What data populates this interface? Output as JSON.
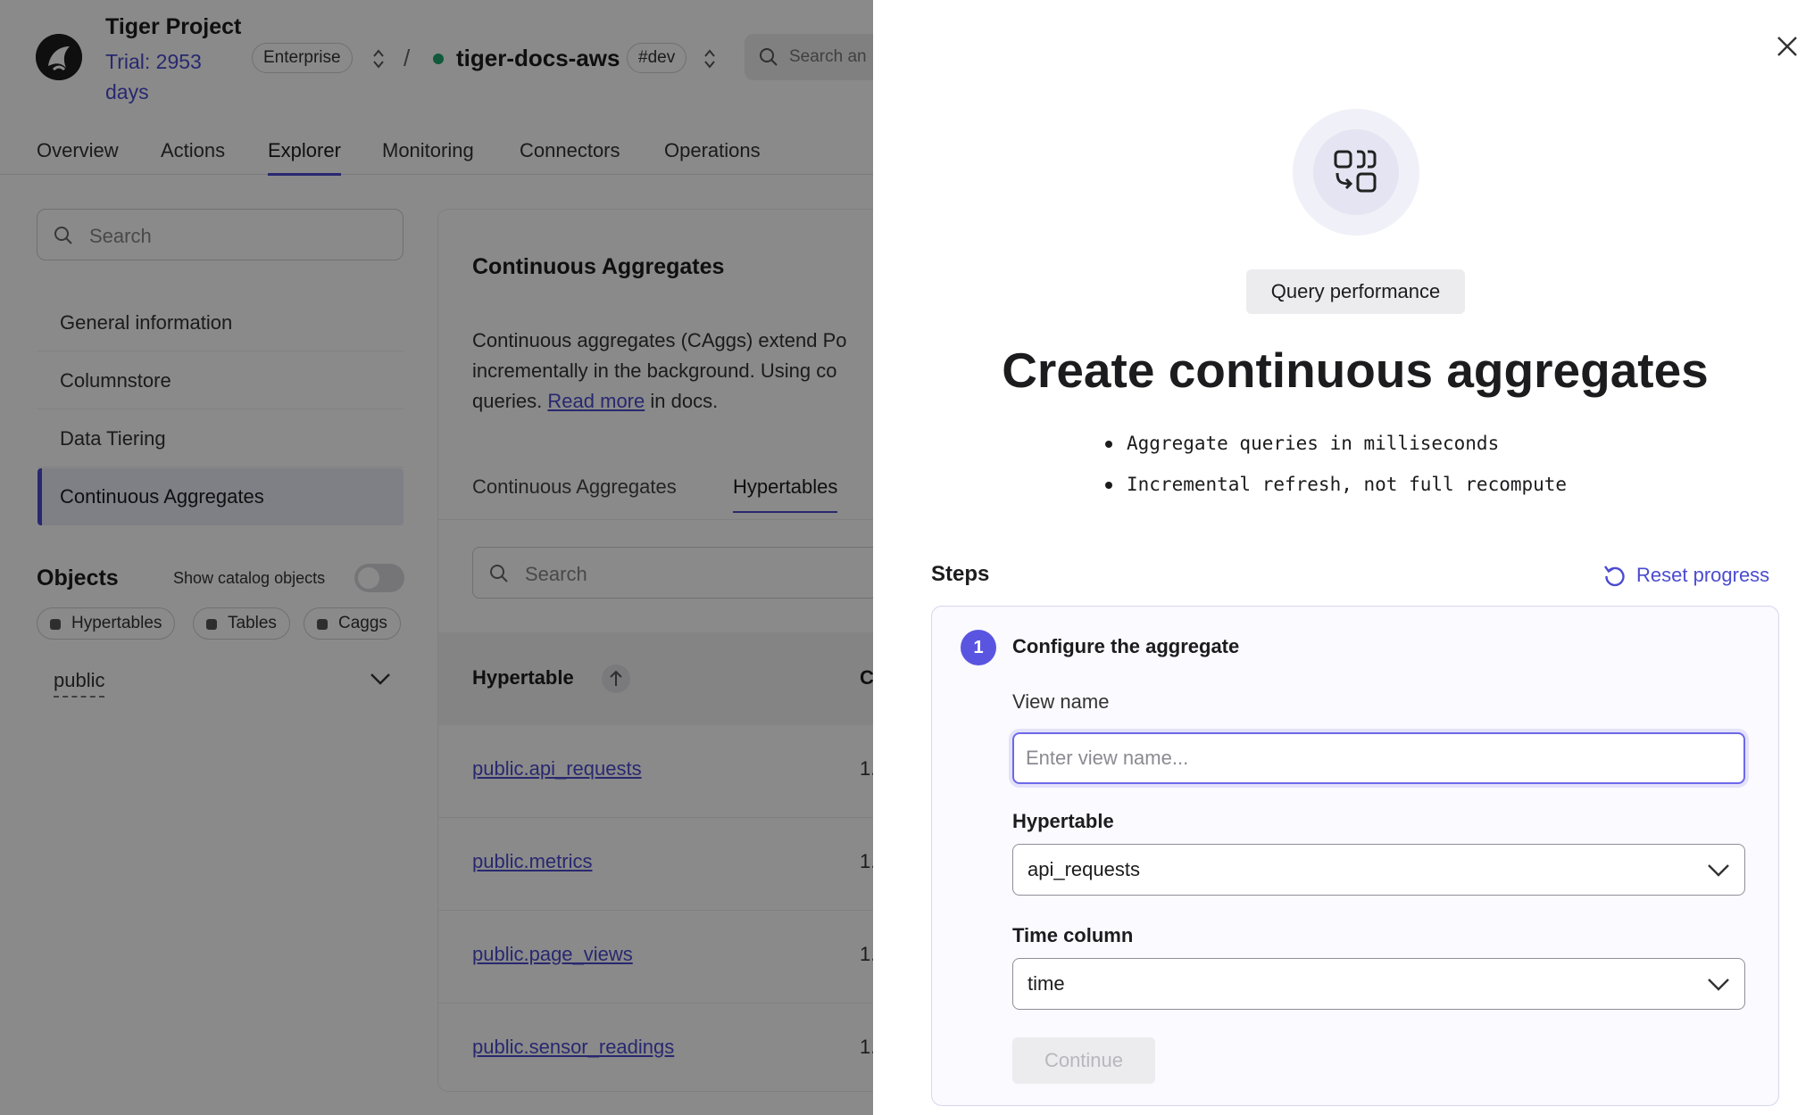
{
  "header": {
    "project_name": "Tiger Project",
    "trial": "Trial: 2953 days",
    "plan": "Enterprise",
    "separator": "/",
    "service_name": "tiger-docs-aws",
    "env_tag": "#dev",
    "search_placeholder": "Search an"
  },
  "nav": {
    "tabs": [
      "Overview",
      "Actions",
      "Explorer",
      "Monitoring",
      "Connectors",
      "Operations"
    ],
    "active": "Explorer"
  },
  "sidebar": {
    "search_placeholder": "Search",
    "items": [
      "General information",
      "Columnstore",
      "Data Tiering",
      "Continuous Aggregates"
    ],
    "active_item": "Continuous Aggregates",
    "objects_title": "Objects",
    "show_catalog_label": "Show catalog objects",
    "chips": [
      "Hypertables",
      "Tables",
      "Caggs"
    ],
    "schema": "public"
  },
  "main": {
    "title": "Continuous Aggregates",
    "desc_line1": "Continuous aggregates (CAggs) extend Po",
    "desc_line2": "incrementally in the background. Using co",
    "desc_line3_pre": "queries.",
    "desc_link": "Read more",
    "desc_line3_post": "in docs.",
    "tabs": [
      "Continuous Aggregates",
      "Hypertables"
    ],
    "active_tab": "Hypertables",
    "table_search_placeholder": "Search",
    "column_header": "Hypertable",
    "column_header_2": "C",
    "rows": [
      {
        "name": "public.api_requests",
        "value": "1."
      },
      {
        "name": "public.metrics",
        "value": "1."
      },
      {
        "name": "public.page_views",
        "value": "1."
      },
      {
        "name": "public.sensor_readings",
        "value": "1."
      }
    ]
  },
  "drawer": {
    "badge": "Query performance",
    "title": "Create continuous aggregates",
    "bullets": [
      "Aggregate queries in milliseconds",
      "Incremental refresh, not full recompute"
    ],
    "steps_label": "Steps",
    "reset_label": "Reset progress",
    "step": {
      "number": "1",
      "title": "Configure the aggregate",
      "view_name_label": "View name",
      "view_name_placeholder": "Enter view name...",
      "view_name_value": "",
      "hypertable_label": "Hypertable",
      "hypertable_value": "api_requests",
      "time_column_label": "Time column",
      "time_column_value": "time",
      "continue_label": "Continue"
    }
  },
  "colors": {
    "accent": "#4b4bd0",
    "step_badge": "#5a55e0",
    "status_green": "#1fa56b",
    "overlay": "rgba(0,0,0,0.46)"
  }
}
